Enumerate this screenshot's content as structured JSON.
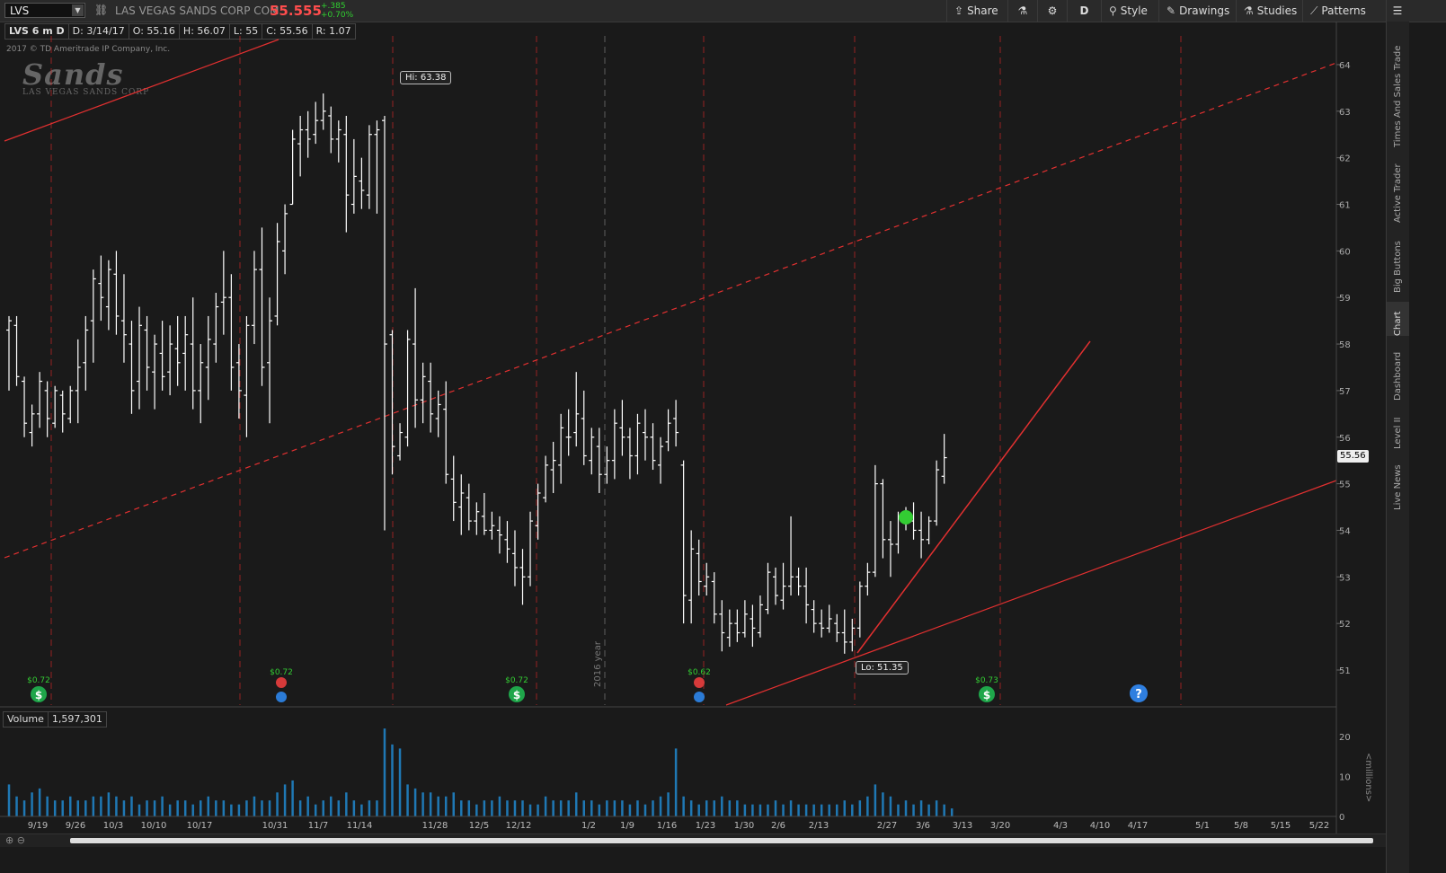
{
  "header": {
    "symbol": "LVS",
    "company": "LAS VEGAS SANDS CORP COM",
    "last": "55.555",
    "change": "+.385",
    "change_pct": "+0.70%",
    "buttons": {
      "share": "Share",
      "d": "D",
      "style": "Style",
      "drawings": "Drawings",
      "studies": "Studies",
      "patterns": "Patterns"
    }
  },
  "info": {
    "label": "LVS 6 m D",
    "date": "D: 3/14/17",
    "open": "O: 55.16",
    "high": "H: 56.07",
    "low": "L: 55",
    "close": "C: 55.56",
    "range": "R: 1.07"
  },
  "copyright": "2017 © TD Ameritrade IP Company, Inc.",
  "logo": {
    "main": "Sands",
    "sub": "LAS VEGAS SANDS CORP"
  },
  "right_tabs": [
    "Trade",
    "Times And Sales",
    "Active Trader",
    "Big Buttons",
    "Chart",
    "Dashboard",
    "Level II",
    "Live News"
  ],
  "volume": {
    "label": "Volume",
    "value": "1,597,301",
    "unit": "<millions>"
  },
  "annotations": {
    "hi": "Hi: 63.38",
    "lo": "Lo: 51.35",
    "price_tag": "55.56",
    "year_label": "2016 year"
  },
  "events": {
    "dividends": [
      "$0.72",
      "$0.72",
      "$0.73"
    ],
    "earnings": [
      "$0.72",
      "$0.62"
    ]
  },
  "chart_data": {
    "type": "bar",
    "title": "",
    "y_ticks": [
      51,
      52,
      53,
      54,
      55,
      56,
      57,
      58,
      59,
      60,
      61,
      62,
      63,
      64
    ],
    "ylim": [
      50.5,
      64.2
    ],
    "vol_ticks": [
      0,
      10,
      20
    ],
    "vol_lim": [
      0,
      22
    ],
    "x_ticks": [
      "9/19",
      "9/26",
      "10/3",
      "10/10",
      "10/17",
      "10/31",
      "11/7",
      "11/14",
      "11/28",
      "12/5",
      "12/12",
      "1/2",
      "1/9",
      "1/16",
      "1/23",
      "1/30",
      "2/6",
      "2/13",
      "2/27",
      "3/6",
      "3/13",
      "3/20",
      "4/3",
      "4/10",
      "4/17",
      "5/1",
      "5/8",
      "5/15",
      "5/22"
    ],
    "colors": {
      "bars": "#ffffff",
      "trend": "#e23030",
      "volume": "#1f78b4",
      "up_dot": "#33cc33"
    },
    "ohlc": [
      [
        58.3,
        58.6,
        57.0,
        58.5
      ],
      [
        58.4,
        58.6,
        57.1,
        57.3
      ],
      [
        57.2,
        57.3,
        56.0,
        56.3
      ],
      [
        56.1,
        56.7,
        55.8,
        56.5
      ],
      [
        56.5,
        57.4,
        56.2,
        57.2
      ],
      [
        57.0,
        57.2,
        56.0,
        56.4
      ],
      [
        56.3,
        57.1,
        56.2,
        57.0
      ],
      [
        56.9,
        57.0,
        56.1,
        56.5
      ],
      [
        56.4,
        57.1,
        56.3,
        57.0
      ],
      [
        57.0,
        58.1,
        56.3,
        57.5
      ],
      [
        57.6,
        58.6,
        57.0,
        58.3
      ],
      [
        58.5,
        59.6,
        57.6,
        59.4
      ],
      [
        59.3,
        59.9,
        58.5,
        59.0
      ],
      [
        58.8,
        59.8,
        58.3,
        59.6
      ],
      [
        59.5,
        60.0,
        58.2,
        58.6
      ],
      [
        58.5,
        59.5,
        57.6,
        58.2
      ],
      [
        58.0,
        58.5,
        56.5,
        57.0
      ],
      [
        57.2,
        58.8,
        56.6,
        58.4
      ],
      [
        58.3,
        58.6,
        57.0,
        57.5
      ],
      [
        57.4,
        58.2,
        56.6,
        58.0
      ],
      [
        57.8,
        58.5,
        57.0,
        57.3
      ],
      [
        57.4,
        58.4,
        56.9,
        58.0
      ],
      [
        57.9,
        58.6,
        57.1,
        57.6
      ],
      [
        57.8,
        58.6,
        57.0,
        58.2
      ],
      [
        58.0,
        59.0,
        56.6,
        57.0
      ],
      [
        57.0,
        58.0,
        56.3,
        57.6
      ],
      [
        57.5,
        58.6,
        56.8,
        58.1
      ],
      [
        58.0,
        59.1,
        57.6,
        58.8
      ],
      [
        58.9,
        60.0,
        58.2,
        59.0
      ],
      [
        59.0,
        59.5,
        57.0,
        57.5
      ],
      [
        57.6,
        58.0,
        56.4,
        57.0
      ],
      [
        56.9,
        58.6,
        56.0,
        58.4
      ],
      [
        58.4,
        60.0,
        58.0,
        59.6
      ],
      [
        59.6,
        60.5,
        57.1,
        57.5
      ],
      [
        57.6,
        59.0,
        56.3,
        58.5
      ],
      [
        58.6,
        60.6,
        58.4,
        60.2
      ],
      [
        60.0,
        61.0,
        59.5,
        60.8
      ],
      [
        61.0,
        62.6,
        61.0,
        62.4
      ],
      [
        62.3,
        62.9,
        61.6,
        62.6
      ],
      [
        62.6,
        63.0,
        62.0,
        62.4
      ],
      [
        62.5,
        63.2,
        62.3,
        62.8
      ],
      [
        62.8,
        63.38,
        62.6,
        63.0
      ],
      [
        62.9,
        63.1,
        62.1,
        62.4
      ],
      [
        62.4,
        62.8,
        61.9,
        62.6
      ],
      [
        62.5,
        62.9,
        60.4,
        61.2
      ],
      [
        61.0,
        62.4,
        60.8,
        61.6
      ],
      [
        61.5,
        62.0,
        60.9,
        61.3
      ],
      [
        61.2,
        62.7,
        60.9,
        62.5
      ],
      [
        62.5,
        62.8,
        60.8,
        62.6
      ],
      [
        62.8,
        62.9,
        54.0,
        58.0
      ],
      [
        58.2,
        58.3,
        55.2,
        55.8
      ],
      [
        55.6,
        56.3,
        55.5,
        56.1
      ],
      [
        56.0,
        58.3,
        55.8,
        58.1
      ],
      [
        58.0,
        59.2,
        56.2,
        56.8
      ],
      [
        56.8,
        57.6,
        56.3,
        57.3
      ],
      [
        57.2,
        57.6,
        56.1,
        56.5
      ],
      [
        56.4,
        57.0,
        56.0,
        56.7
      ],
      [
        56.6,
        57.2,
        55.0,
        55.2
      ],
      [
        55.1,
        55.6,
        54.2,
        54.6
      ],
      [
        54.5,
        55.2,
        53.9,
        54.8
      ],
      [
        54.7,
        55.0,
        54.0,
        54.2
      ],
      [
        54.2,
        54.6,
        53.9,
        54.4
      ],
      [
        54.3,
        54.8,
        53.9,
        54.0
      ],
      [
        54.0,
        54.4,
        53.8,
        54.1
      ],
      [
        54.0,
        54.3,
        53.5,
        53.9
      ],
      [
        53.8,
        54.2,
        53.3,
        53.6
      ],
      [
        53.5,
        54.0,
        52.8,
        53.2
      ],
      [
        53.2,
        53.6,
        52.4,
        53.0
      ],
      [
        53.0,
        54.4,
        52.8,
        54.2
      ],
      [
        54.1,
        55.0,
        53.8,
        54.8
      ],
      [
        54.7,
        55.6,
        54.6,
        55.4
      ],
      [
        55.3,
        55.9,
        54.8,
        55.5
      ],
      [
        55.4,
        56.5,
        55.0,
        56.2
      ],
      [
        56.0,
        56.6,
        55.6,
        56.0
      ],
      [
        56.1,
        57.4,
        55.8,
        56.5
      ],
      [
        56.4,
        57.0,
        55.4,
        55.6
      ],
      [
        55.5,
        56.2,
        55.2,
        56.0
      ],
      [
        55.8,
        56.2,
        54.8,
        55.2
      ],
      [
        55.2,
        55.8,
        55.0,
        55.5
      ],
      [
        55.5,
        56.6,
        55.1,
        56.3
      ],
      [
        56.2,
        56.8,
        55.6,
        56.0
      ],
      [
        56.0,
        56.2,
        55.1,
        55.6
      ],
      [
        55.6,
        56.5,
        55.2,
        56.3
      ],
      [
        56.1,
        56.6,
        55.5,
        56.0
      ],
      [
        56.0,
        56.3,
        55.3,
        55.5
      ],
      [
        55.4,
        56.0,
        55.0,
        55.8
      ],
      [
        55.9,
        56.6,
        55.7,
        56.3
      ],
      [
        56.4,
        56.8,
        55.8,
        56.1
      ],
      [
        55.4,
        55.5,
        52.0,
        52.6
      ],
      [
        52.5,
        54.0,
        52.0,
        53.6
      ],
      [
        53.5,
        53.8,
        52.6,
        52.9
      ],
      [
        52.8,
        53.3,
        52.6,
        53.0
      ],
      [
        52.9,
        53.1,
        52.0,
        52.2
      ],
      [
        52.2,
        52.5,
        51.4,
        51.8
      ],
      [
        51.7,
        52.3,
        51.5,
        52.0
      ],
      [
        52.0,
        52.3,
        51.6,
        51.8
      ],
      [
        51.8,
        52.5,
        51.7,
        52.2
      ],
      [
        52.1,
        52.4,
        51.5,
        51.9
      ],
      [
        51.8,
        52.6,
        51.7,
        52.4
      ],
      [
        52.3,
        53.3,
        52.2,
        53.1
      ],
      [
        53.0,
        53.2,
        52.4,
        52.6
      ],
      [
        52.5,
        53.3,
        52.3,
        52.8
      ],
      [
        52.8,
        54.3,
        52.6,
        53.0
      ],
      [
        53.0,
        53.2,
        52.6,
        52.8
      ],
      [
        52.8,
        53.2,
        52.0,
        52.4
      ],
      [
        52.3,
        52.5,
        51.8,
        52.0
      ],
      [
        52.0,
        52.3,
        51.7,
        51.9
      ],
      [
        51.9,
        52.4,
        51.8,
        52.1
      ],
      [
        52.0,
        52.2,
        51.6,
        51.8
      ],
      [
        51.8,
        52.3,
        51.35,
        51.6
      ],
      [
        51.6,
        52.1,
        51.4,
        51.9
      ],
      [
        51.9,
        52.9,
        51.7,
        52.8
      ],
      [
        52.8,
        53.3,
        52.6,
        53.1
      ],
      [
        53.1,
        55.4,
        53.0,
        55.0
      ],
      [
        55.0,
        55.1,
        53.4,
        53.8
      ],
      [
        53.8,
        54.2,
        53.0,
        53.7
      ],
      [
        53.7,
        54.4,
        53.5,
        54.3
      ],
      [
        54.3,
        54.5,
        54.0,
        54.2
      ],
      [
        54.2,
        54.6,
        53.8,
        54.0
      ],
      [
        54.0,
        54.4,
        53.4,
        53.8
      ],
      [
        53.8,
        54.3,
        53.7,
        54.2
      ],
      [
        54.2,
        55.5,
        54.1,
        55.3
      ],
      [
        55.16,
        56.07,
        55.0,
        55.56
      ]
    ],
    "volume": [
      8,
      5,
      4,
      6,
      7,
      5,
      4,
      4,
      5,
      4,
      4,
      5,
      5,
      6,
      5,
      4,
      5,
      3,
      4,
      4,
      5,
      3,
      4,
      4,
      3,
      4,
      5,
      4,
      4,
      3,
      3,
      4,
      5,
      4,
      4,
      6,
      8,
      9,
      4,
      5,
      3,
      4,
      5,
      4,
      6,
      4,
      3,
      4,
      4,
      22,
      18,
      17,
      8,
      7,
      6,
      6,
      5,
      5,
      6,
      4,
      4,
      3,
      4,
      4,
      5,
      4,
      4,
      4,
      3,
      3,
      5,
      4,
      4,
      4,
      6,
      4,
      4,
      3,
      4,
      4,
      4,
      3,
      4,
      3,
      4,
      5,
      6,
      17,
      5,
      4,
      3,
      4,
      4,
      5,
      4,
      4,
      3,
      3,
      3,
      3,
      4,
      3,
      4,
      3,
      3,
      3,
      3,
      3,
      3,
      4,
      3,
      4,
      5,
      8,
      6,
      5,
      3,
      4,
      3,
      4,
      3,
      4,
      3,
      2
    ]
  }
}
